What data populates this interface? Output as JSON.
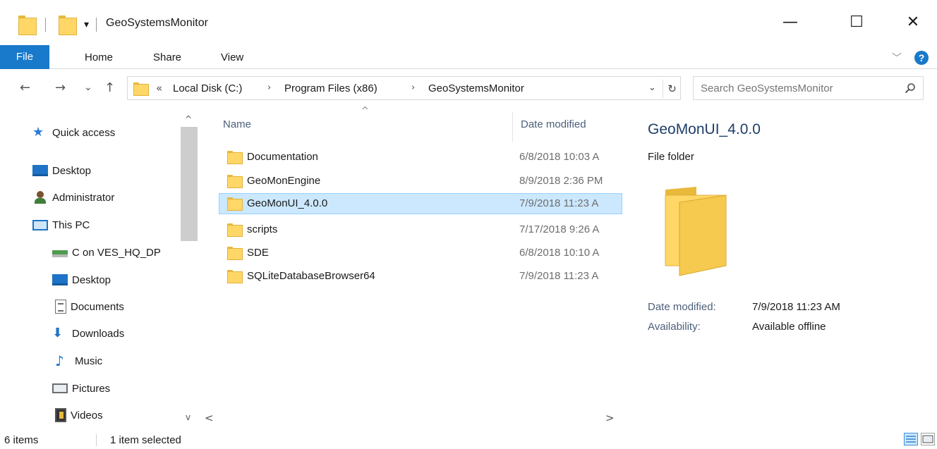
{
  "window": {
    "title": "GeoSystemsMonitor",
    "minimize_glyph": "—",
    "maximize_glyph": "☐",
    "close_glyph": "✕",
    "qat_dropdown_glyph": "▾"
  },
  "ribbon": {
    "tabs": [
      "File",
      "Home",
      "Share",
      "View"
    ],
    "expand_glyph": "﹀",
    "help_glyph": "?"
  },
  "nav": {
    "back_glyph": "←",
    "forward_glyph": "→",
    "recent_glyph": "⌄",
    "up_glyph": "↑"
  },
  "address": {
    "overflow": "«",
    "separator": "›",
    "crumbs": [
      "Local Disk (C:)",
      "Program Files (x86)",
      "GeoSystemsMonitor"
    ],
    "dropdown_glyph": "⌄",
    "refresh_glyph": "↻"
  },
  "search": {
    "placeholder": "Search GeoSystemsMonitor"
  },
  "sidebar": {
    "items": [
      {
        "label": "Quick access",
        "icon": "star-icon"
      },
      {
        "label": "Desktop",
        "icon": "desktop-icon"
      },
      {
        "label": "Administrator",
        "icon": "user-icon"
      },
      {
        "label": "This PC",
        "icon": "computer-icon"
      },
      {
        "label": "C on VES_HQ_DP",
        "icon": "network-drive-icon"
      },
      {
        "label": "Desktop",
        "icon": "desktop-icon"
      },
      {
        "label": "Documents",
        "icon": "documents-icon"
      },
      {
        "label": "Downloads",
        "icon": "downloads-icon"
      },
      {
        "label": "Music",
        "icon": "music-icon"
      },
      {
        "label": "Pictures",
        "icon": "pictures-icon"
      },
      {
        "label": "Videos",
        "icon": "videos-icon"
      }
    ],
    "scroll_up_glyph": "^",
    "scroll_down_glyph": "v"
  },
  "filelist": {
    "sort_glyph": "^",
    "columns": [
      "Name",
      "Date modified"
    ],
    "rows": [
      {
        "name": "Documentation",
        "date": "6/8/2018 10:03 A",
        "selected": false
      },
      {
        "name": "GeoMonEngine",
        "date": "8/9/2018 2:36 PM",
        "selected": false
      },
      {
        "name": "GeoMonUI_4.0.0",
        "date": "7/9/2018 11:23 A",
        "selected": true
      },
      {
        "name": "scripts",
        "date": "7/17/2018 9:26 A",
        "selected": false
      },
      {
        "name": "SDE",
        "date": "6/8/2018 10:10 A",
        "selected": false
      },
      {
        "name": "SQLiteDatabaseBrowser64",
        "date": "7/9/2018 11:23 A",
        "selected": false
      }
    ],
    "hscroll_left_glyph": "<",
    "hscroll_right_glyph": ">"
  },
  "details": {
    "title": "GeoMonUI_4.0.0",
    "type": "File folder",
    "date_modified_label": "Date modified:",
    "date_modified_value": "7/9/2018 11:23 AM",
    "availability_label": "Availability:",
    "availability_value": "Available offline"
  },
  "status": {
    "item_count": "6 items",
    "selection": "1 item selected"
  },
  "colors": {
    "accent": "#1979ca",
    "selection_bg": "#cce8ff",
    "selection_border": "#99d1ff",
    "folder": "#ffd767"
  }
}
